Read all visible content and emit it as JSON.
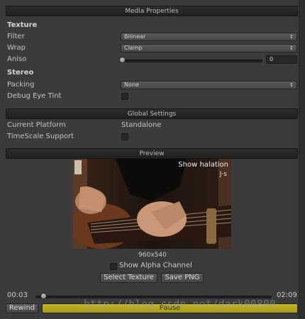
{
  "media_properties": {
    "header": "Media Properties",
    "texture_section": "Texture",
    "filter": {
      "label": "Filter",
      "value": "Bilinear"
    },
    "wrap": {
      "label": "Wrap",
      "value": "Clamp"
    },
    "aniso": {
      "label": "Aniso",
      "value": "0"
    },
    "stereo_section": "Stereo",
    "packing": {
      "label": "Packing",
      "value": "None"
    },
    "debug_eye_tint": {
      "label": "Debug Eye Tint",
      "checked": false
    }
  },
  "global_settings": {
    "header": "Global Settings",
    "current_platform": {
      "label": "Current Platform",
      "value": "Standalone"
    },
    "timescale_support": {
      "label": "TimeScale Support",
      "checked": false
    }
  },
  "preview": {
    "header": "Preview",
    "overlay_text": "Show halation",
    "overlay_subtext": "J·s",
    "resolution": "960x540",
    "show_alpha_label": "Show Alpha Channel",
    "select_texture_label": "Select Texture",
    "save_png_label": "Save PNG"
  },
  "playback": {
    "current_time": "00:03",
    "total_time": "02:09",
    "progress": 0.02,
    "rewind_label": "Rewind",
    "pause_label": "Pause",
    "pause_color": "#b8a81c"
  },
  "watermark": "http://blog.csdn.net/dark00800"
}
